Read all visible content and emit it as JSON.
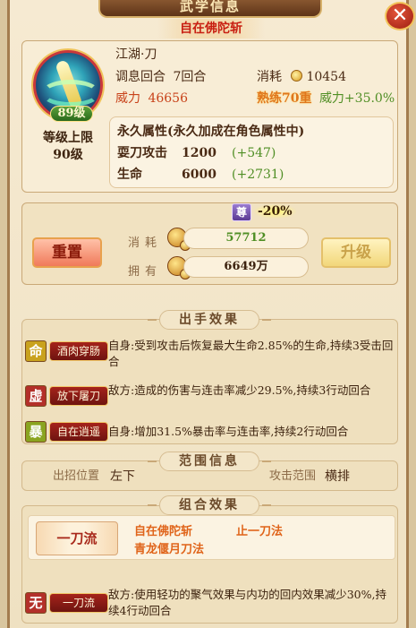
{
  "window": {
    "title": "武学信息",
    "close_label": "✕"
  },
  "skill": {
    "name": "自在佛陀斩",
    "category": "江湖·刀",
    "level_badge": "89级",
    "level_cap_line1": "等级上限",
    "level_cap_line2": "90级",
    "adjust_label": "调息回合",
    "adjust_value": "7回合",
    "cost_label": "消耗",
    "cost_value": "10454",
    "power_label": "威力",
    "power_value": "46656",
    "mastery_tag": "熟练70重",
    "power_bonus": "威力+35.0%"
  },
  "permanent": {
    "title": "永久属性(永久加成在角色属性中)",
    "rows": [
      {
        "label": "耍刀攻击",
        "value": "1200",
        "bonus": "(+547)"
      },
      {
        "label": "生命",
        "value": "6000",
        "bonus": "(+2731)"
      }
    ]
  },
  "upgrade": {
    "honor_tag": "尊",
    "discount": "-20%",
    "reset_label": "重置",
    "upgrade_label": "升级",
    "cost_row_label": "消耗",
    "cost_row_value": "57712",
    "own_row_label": "拥有",
    "own_row_value": "6649万"
  },
  "effects": {
    "title": "出手效果",
    "items": [
      {
        "icon": "命",
        "icon_color": "#c9a21e",
        "tag": "酒肉穿肠",
        "text": "自身:受到攻击后恢复最大生命2.85%的生命,持续3受击回合"
      },
      {
        "icon": "虚",
        "icon_color": "#b3302a",
        "tag": "放下屠刀",
        "text": "敌方:造成的伤害与连击率减少29.5%,持续3行动回合"
      },
      {
        "icon": "暴",
        "icon_color": "#8aa420",
        "tag": "自在逍遥",
        "text": "自身:增加31.5%暴击率与连击率,持续2行动回合"
      }
    ]
  },
  "range": {
    "title": "范围信息",
    "position_label": "出招位置",
    "position_value": "左下",
    "attack_label": "攻击范围",
    "attack_value": "横排"
  },
  "combo": {
    "title": "组合效果",
    "card_label": "一刀流",
    "skills": [
      "自在佛陀斩",
      "止一刀法",
      "青龙偃月刀法"
    ],
    "effect_icon": "无",
    "effect_tag": "一刀流",
    "effect_text": "敌方:使用轻功的聚气效果与内功的回内效果减少30%,持续4行动回合"
  },
  "colors": {
    "accent_red": "#c81f12",
    "bonus_green": "#4f8e24",
    "power_orange": "#c8421a"
  }
}
